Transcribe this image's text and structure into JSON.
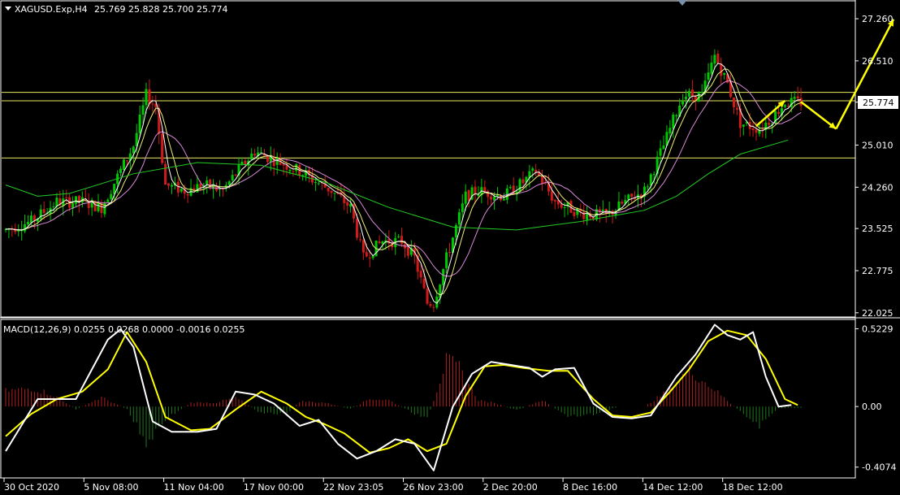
{
  "header": {
    "symbol_info": "XAGUSD.Exp,H4",
    "ohlc": "25.769 25.828 25.700 25.774"
  },
  "macd_header": "MACD(12,26,9) 0.0255 0.0268 0.0000 -0.0016 0.0255",
  "price_badge": "25.774",
  "colors": {
    "background": "#000000",
    "bull_candle": "#00c800",
    "bear_candle": "#d11a1a",
    "ma_fast": "#ffffff",
    "ma_mid": "#f0f07a",
    "ma_slow": "#d88ad8",
    "ma_long": "#22cc22",
    "hlines": "#e8e860",
    "arrow": "#ffff00",
    "macd_main": "#ffffff",
    "macd_signal": "#ffff00",
    "hist_pos": "#b02020",
    "hist_neg": "#1f7a1f"
  },
  "chart_data": [
    {
      "type": "candlestick",
      "symbol": "XAGUSD.Exp",
      "timeframe": "H4",
      "y_ticks": [
        "27.260",
        "26.510",
        "25.775",
        "25.010",
        "24.260",
        "23.525",
        "22.775",
        "22.025"
      ],
      "ylim": [
        21.95,
        27.55
      ],
      "x_ticks": [
        "30 Oct 2020",
        "5 Nov 08:00",
        "11 Nov 04:00",
        "17 Nov 00:00",
        "22 Nov 23:05",
        "26 Nov 23:00",
        "2 Dec 20:00",
        "8 Dec 16:00",
        "14 Dec 12:00",
        "18 Dec 12:00"
      ],
      "hlines": [
        25.95,
        25.8,
        24.78
      ],
      "price_path": [
        [
          0,
          23.5
        ],
        [
          8,
          23.65
        ],
        [
          16,
          24.0
        ],
        [
          24,
          24.0
        ],
        [
          30,
          23.9
        ],
        [
          40,
          25.0
        ],
        [
          44,
          25.9
        ],
        [
          47,
          25.7
        ],
        [
          50,
          24.3
        ],
        [
          56,
          24.2
        ],
        [
          62,
          24.3
        ],
        [
          68,
          24.2
        ],
        [
          72,
          24.5
        ],
        [
          78,
          24.9
        ],
        [
          86,
          24.7
        ],
        [
          92,
          24.55
        ],
        [
          96,
          24.4
        ],
        [
          102,
          24.2
        ],
        [
          108,
          23.9
        ],
        [
          112,
          23.0
        ],
        [
          118,
          23.3
        ],
        [
          124,
          23.3
        ],
        [
          128,
          23.0
        ],
        [
          132,
          22.2
        ],
        [
          134,
          22.2
        ],
        [
          138,
          23.0
        ],
        [
          144,
          24.1
        ],
        [
          148,
          24.2
        ],
        [
          156,
          24.1
        ],
        [
          162,
          24.35
        ],
        [
          166,
          24.55
        ],
        [
          172,
          24.0
        ],
        [
          180,
          23.8
        ],
        [
          188,
          23.75
        ],
        [
          194,
          24.0
        ],
        [
          200,
          24.2
        ],
        [
          206,
          25.0
        ],
        [
          212,
          25.9
        ],
        [
          218,
          25.9
        ],
        [
          222,
          26.6
        ],
        [
          226,
          26.1
        ],
        [
          230,
          25.4
        ],
        [
          236,
          25.3
        ],
        [
          240,
          25.5
        ],
        [
          244,
          25.77
        ]
      ],
      "ma_long_path": [
        [
          0,
          24.3
        ],
        [
          10,
          24.1
        ],
        [
          20,
          24.15
        ],
        [
          40,
          24.5
        ],
        [
          60,
          24.7
        ],
        [
          80,
          24.65
        ],
        [
          100,
          24.35
        ],
        [
          120,
          23.9
        ],
        [
          140,
          23.55
        ],
        [
          160,
          23.5
        ],
        [
          180,
          23.65
        ],
        [
          200,
          23.85
        ],
        [
          210,
          24.1
        ],
        [
          220,
          24.5
        ],
        [
          230,
          24.85
        ],
        [
          245,
          25.1
        ]
      ],
      "arrows": [
        {
          "from": [
            235,
            25.35
          ],
          "to": [
            244,
            25.8
          ]
        },
        {
          "from": [
            249,
            25.78
          ],
          "to": [
            260,
            25.3
          ],
          "to2": [
            278,
            27.25
          ]
        }
      ]
    },
    {
      "type": "line",
      "name": "MACD(12,26,9)",
      "y_ticks": [
        "0.5229",
        "0.00",
        "-0.4074"
      ],
      "ylim": [
        -0.48,
        0.58
      ],
      "main_path": [
        [
          0,
          -0.3
        ],
        [
          10,
          0.05
        ],
        [
          16,
          0.05
        ],
        [
          22,
          0.05
        ],
        [
          32,
          0.45
        ],
        [
          36,
          0.52
        ],
        [
          40,
          0.4
        ],
        [
          46,
          -0.1
        ],
        [
          52,
          -0.17
        ],
        [
          60,
          -0.17
        ],
        [
          66,
          -0.15
        ],
        [
          72,
          0.1
        ],
        [
          78,
          0.08
        ],
        [
          84,
          0.02
        ],
        [
          92,
          -0.13
        ],
        [
          98,
          -0.09
        ],
        [
          104,
          -0.25
        ],
        [
          110,
          -0.35
        ],
        [
          116,
          -0.3
        ],
        [
          122,
          -0.22
        ],
        [
          128,
          -0.25
        ],
        [
          134,
          -0.43
        ],
        [
          140,
          0.0
        ],
        [
          146,
          0.22
        ],
        [
          152,
          0.3
        ],
        [
          158,
          0.28
        ],
        [
          164,
          0.26
        ],
        [
          168,
          0.2
        ],
        [
          172,
          0.25
        ],
        [
          178,
          0.26
        ],
        [
          184,
          0.02
        ],
        [
          190,
          -0.07
        ],
        [
          196,
          -0.08
        ],
        [
          202,
          -0.06
        ],
        [
          210,
          0.2
        ],
        [
          216,
          0.35
        ],
        [
          222,
          0.55
        ],
        [
          226,
          0.48
        ],
        [
          230,
          0.45
        ],
        [
          234,
          0.5
        ],
        [
          238,
          0.2
        ],
        [
          242,
          0.0
        ],
        [
          246,
          0.01
        ]
      ],
      "signal_path": [
        [
          0,
          -0.2
        ],
        [
          8,
          -0.05
        ],
        [
          16,
          0.05
        ],
        [
          24,
          0.1
        ],
        [
          32,
          0.25
        ],
        [
          38,
          0.5
        ],
        [
          44,
          0.3
        ],
        [
          50,
          -0.07
        ],
        [
          58,
          -0.16
        ],
        [
          64,
          -0.15
        ],
        [
          72,
          -0.02
        ],
        [
          80,
          0.1
        ],
        [
          88,
          0.02
        ],
        [
          94,
          -0.07
        ],
        [
          100,
          -0.12
        ],
        [
          106,
          -0.18
        ],
        [
          114,
          -0.31
        ],
        [
          120,
          -0.28
        ],
        [
          126,
          -0.22
        ],
        [
          132,
          -0.3
        ],
        [
          138,
          -0.25
        ],
        [
          144,
          0.07
        ],
        [
          150,
          0.27
        ],
        [
          156,
          0.28
        ],
        [
          162,
          0.26
        ],
        [
          170,
          0.24
        ],
        [
          176,
          0.24
        ],
        [
          184,
          0.05
        ],
        [
          190,
          -0.06
        ],
        [
          196,
          -0.07
        ],
        [
          202,
          -0.04
        ],
        [
          208,
          0.1
        ],
        [
          214,
          0.25
        ],
        [
          220,
          0.44
        ],
        [
          226,
          0.51
        ],
        [
          232,
          0.48
        ],
        [
          238,
          0.32
        ],
        [
          244,
          0.05
        ],
        [
          248,
          0.01
        ]
      ],
      "hist_path": [
        [
          0,
          0.12
        ],
        [
          8,
          0.14
        ],
        [
          14,
          0.1
        ],
        [
          22,
          -0.02
        ],
        [
          30,
          0.07
        ],
        [
          38,
          -0.02
        ],
        [
          44,
          -0.28
        ],
        [
          50,
          -0.1
        ],
        [
          58,
          0.03
        ],
        [
          66,
          0.03
        ],
        [
          72,
          0.07
        ],
        [
          80,
          -0.05
        ],
        [
          88,
          -0.06
        ],
        [
          92,
          0.04
        ],
        [
          100,
          0.03
        ],
        [
          108,
          -0.02
        ],
        [
          114,
          0.06
        ],
        [
          120,
          0.05
        ],
        [
          126,
          -0.03
        ],
        [
          132,
          -0.1
        ],
        [
          138,
          0.35
        ],
        [
          142,
          0.3
        ],
        [
          148,
          0.05
        ],
        [
          154,
          0.02
        ],
        [
          160,
          -0.03
        ],
        [
          168,
          0.05
        ],
        [
          176,
          -0.08
        ],
        [
          184,
          -0.06
        ],
        [
          192,
          0.0
        ],
        [
          200,
          0.0
        ],
        [
          206,
          0.1
        ],
        [
          214,
          0.28
        ],
        [
          222,
          0.13
        ],
        [
          230,
          -0.04
        ],
        [
          236,
          -0.15
        ],
        [
          242,
          -0.01
        ],
        [
          248,
          -0.01
        ]
      ]
    }
  ]
}
